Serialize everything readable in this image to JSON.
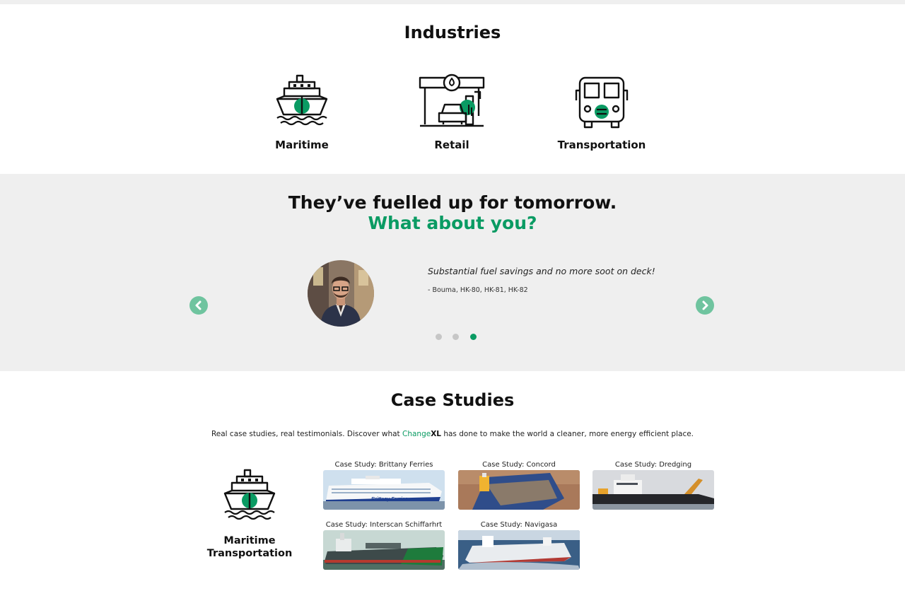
{
  "industries": {
    "title": "Industries",
    "items": [
      {
        "label": "Maritime",
        "icon": "ship-icon"
      },
      {
        "label": "Retail",
        "icon": "fuel-station-icon"
      },
      {
        "label": "Transportation",
        "icon": "bus-icon"
      }
    ]
  },
  "testimonials": {
    "headline": "They’ve fuelled up for tomorrow.",
    "subheadline": "What about you?",
    "quote": "Substantial fuel savings and no more soot on deck!",
    "author": "- Bouma, HK-80, HK-81, HK-82",
    "active_slide": 3,
    "slide_count": 3
  },
  "case_studies": {
    "title": "Case Studies",
    "description_before": "Real case studies, real testimonials. Discover what ",
    "brand_change": "Change",
    "brand_xl": "XL",
    "description_after": " has done to make the world a cleaner, more energy efficient place.",
    "category_label_line1": "Maritime",
    "category_label_line2": "Transportation",
    "cards": [
      {
        "title": "Case Study: Brittany Ferries",
        "image_text": "Brittany Ferries"
      },
      {
        "title": "Case Study: Concord"
      },
      {
        "title": "Case Study: Dredging"
      },
      {
        "title": "Case Study: Interscan Schiffarhrt"
      },
      {
        "title": "Case Study: Navigasa"
      }
    ]
  },
  "colors": {
    "accent": "#0a9b63",
    "arrow": "#6fc49f",
    "band": "#efefef"
  }
}
